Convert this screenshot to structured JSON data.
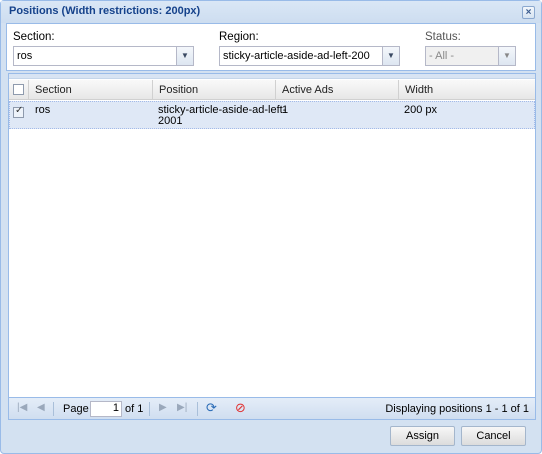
{
  "window": {
    "title": "Positions (Width restrictions: 200px)",
    "close_glyph": "×"
  },
  "filters": {
    "section": {
      "label": "Section:",
      "value": "ros"
    },
    "region": {
      "label": "Region:",
      "value": "sticky-article-aside-ad-left-200"
    },
    "status": {
      "label": "Status:",
      "value": "- All -"
    }
  },
  "grid": {
    "columns": [
      "Section",
      "Position",
      "Active Ads",
      "Width"
    ],
    "rows": [
      {
        "checked": true,
        "section": "ros",
        "position_line1": "sticky-article-aside-ad-left-",
        "position_line2": "2001",
        "active_ads": "1",
        "width": "200 px"
      }
    ]
  },
  "pager": {
    "page_label": "Page",
    "page_value": "1",
    "of_label": "of 1",
    "display_msg": "Displaying positions 1 - 1 of 1"
  },
  "buttons": {
    "assign": "Assign",
    "cancel": "Cancel"
  },
  "colors": {
    "accent": "#15428b",
    "selected_row": "#dfe8f6",
    "border": "#99bbe8"
  }
}
